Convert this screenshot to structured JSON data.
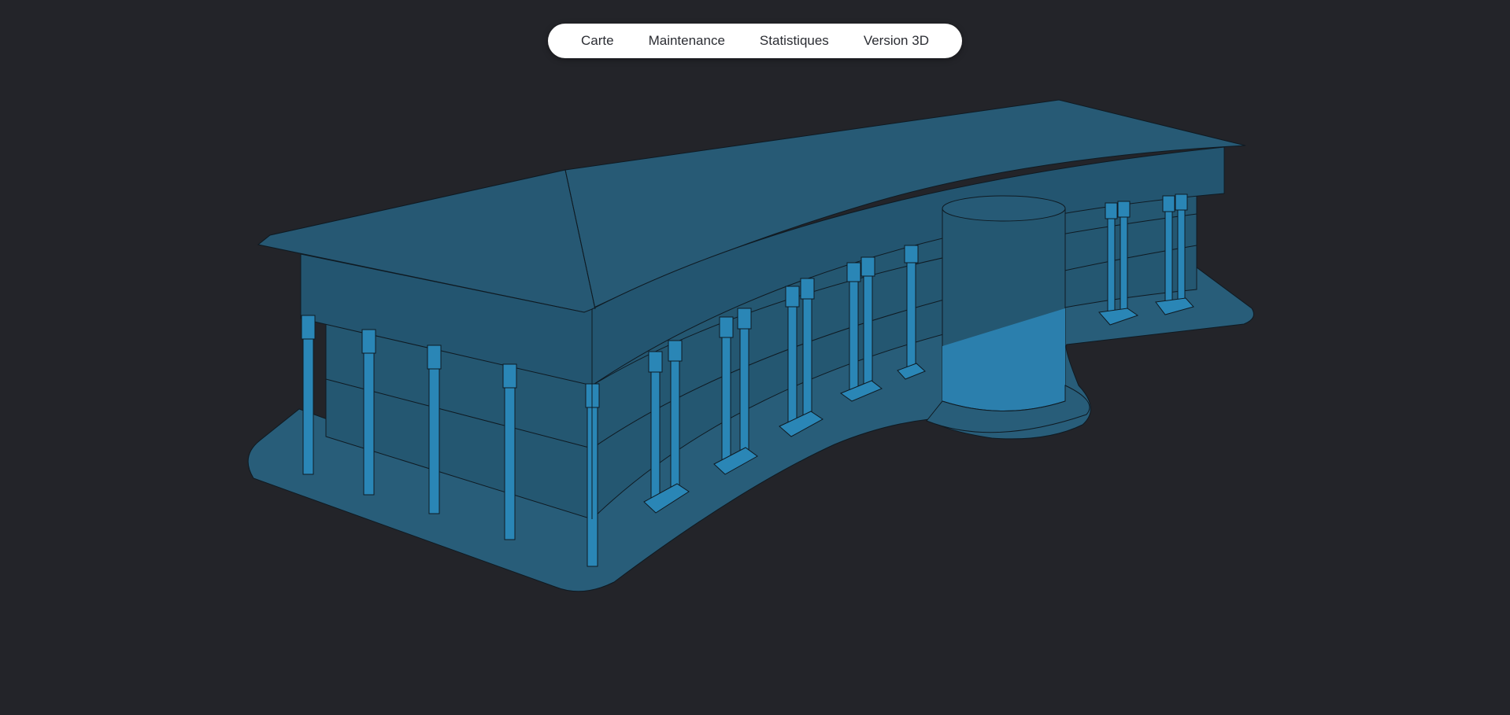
{
  "nav": {
    "items": [
      {
        "label": "Carte"
      },
      {
        "label": "Maintenance"
      },
      {
        "label": "Statistiques"
      },
      {
        "label": "Version 3D"
      }
    ]
  },
  "colors": {
    "background": "#232429",
    "building_fill": "#275a75",
    "building_face": "#245771",
    "pillar_fill": "#2a86b6",
    "glass_fill": "#2b7fad",
    "ground_fill": "#285d79",
    "outline": "#0f1a22"
  }
}
